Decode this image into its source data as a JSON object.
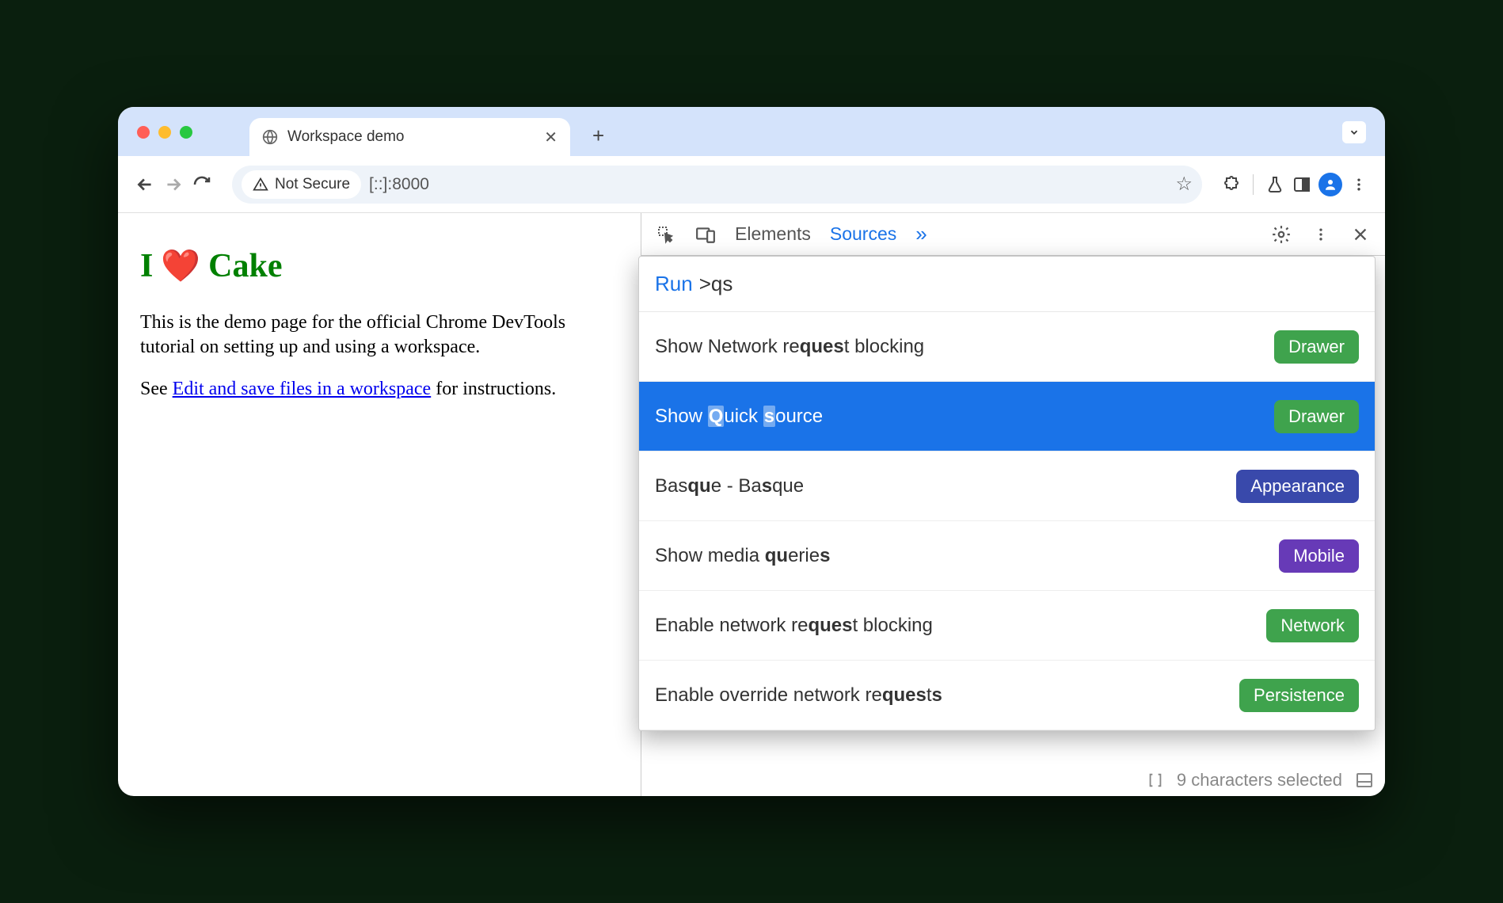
{
  "browser": {
    "tab_title": "Workspace demo",
    "security_label": "Not Secure",
    "url": "[::]:8000"
  },
  "page": {
    "heading_prefix": "I",
    "heading_suffix": "Cake",
    "para1": "This is the demo page for the official Chrome DevTools tutorial on setting up and using a workspace.",
    "para2_pre": "See ",
    "para2_link": "Edit and save files in a workspace",
    "para2_post": " for instructions."
  },
  "devtools": {
    "tabs": {
      "elements": "Elements",
      "sources": "Sources"
    },
    "cmd": {
      "run_label": "Run",
      "query": ">qs",
      "rows": [
        {
          "pre": "Show Network re",
          "m1": "ques",
          "mid": "t blocking",
          "badge": "Drawer",
          "badgeClass": "bg-drawer"
        },
        {
          "pre": "Show ",
          "m1": "Q",
          "mid": "uick ",
          "m2": "s",
          "post": "ource",
          "badge": "Drawer",
          "badgeClass": "bg-drawer",
          "sel": true
        },
        {
          "pre": "Bas",
          "m1": "qu",
          "mid": "e - Ba",
          "m2": "s",
          "post": "que",
          "badge": "Appearance",
          "badgeClass": "bg-appearance"
        },
        {
          "pre": "Show media ",
          "m1": "qu",
          "mid": "erie",
          "m2": "s",
          "post": "",
          "badge": "Mobile",
          "badgeClass": "bg-mobile"
        },
        {
          "pre": "Enable network re",
          "m1": "ques",
          "mid": "t blocking",
          "badge": "Network",
          "badgeClass": "bg-network"
        },
        {
          "pre": "Enable override network re",
          "m1": "ques",
          "mid": "t",
          "m2": "s",
          "post": "",
          "badge": "Persistence",
          "badgeClass": "bg-persist"
        }
      ]
    },
    "status_text": "9 characters selected"
  }
}
